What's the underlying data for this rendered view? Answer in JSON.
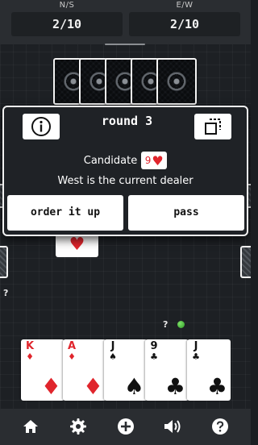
{
  "scores": {
    "ns": {
      "label": "N/S",
      "value": "2/10"
    },
    "ew": {
      "label": "E/W",
      "value": "2/10"
    }
  },
  "dialog": {
    "title": "round 3",
    "candidate_label": "Candidate",
    "candidate_card": {
      "rank": "9",
      "suit": "♥"
    },
    "dealer_text": "West is the current dealer",
    "order_button": "order it up",
    "pass_button": "pass"
  },
  "table": {
    "west_marker": "?",
    "south_marker": "?",
    "played_card_suit": "♥",
    "north_card_count": 5
  },
  "hand": [
    {
      "rank": "K",
      "suit": "♦",
      "color": "red"
    },
    {
      "rank": "A",
      "suit": "♦",
      "color": "red"
    },
    {
      "rank": "J",
      "suit": "♠",
      "color": "black"
    },
    {
      "rank": "9",
      "suit": "♣",
      "color": "black"
    },
    {
      "rank": "J",
      "suit": "♣",
      "color": "black"
    }
  ],
  "colors": {
    "background": "#1d2024",
    "red_suit": "#e0252c",
    "status_dot": "#3fbf30"
  },
  "nav": {
    "icons": [
      "home-icon",
      "gear-icon",
      "add-icon",
      "sound-icon",
      "help-icon"
    ]
  }
}
